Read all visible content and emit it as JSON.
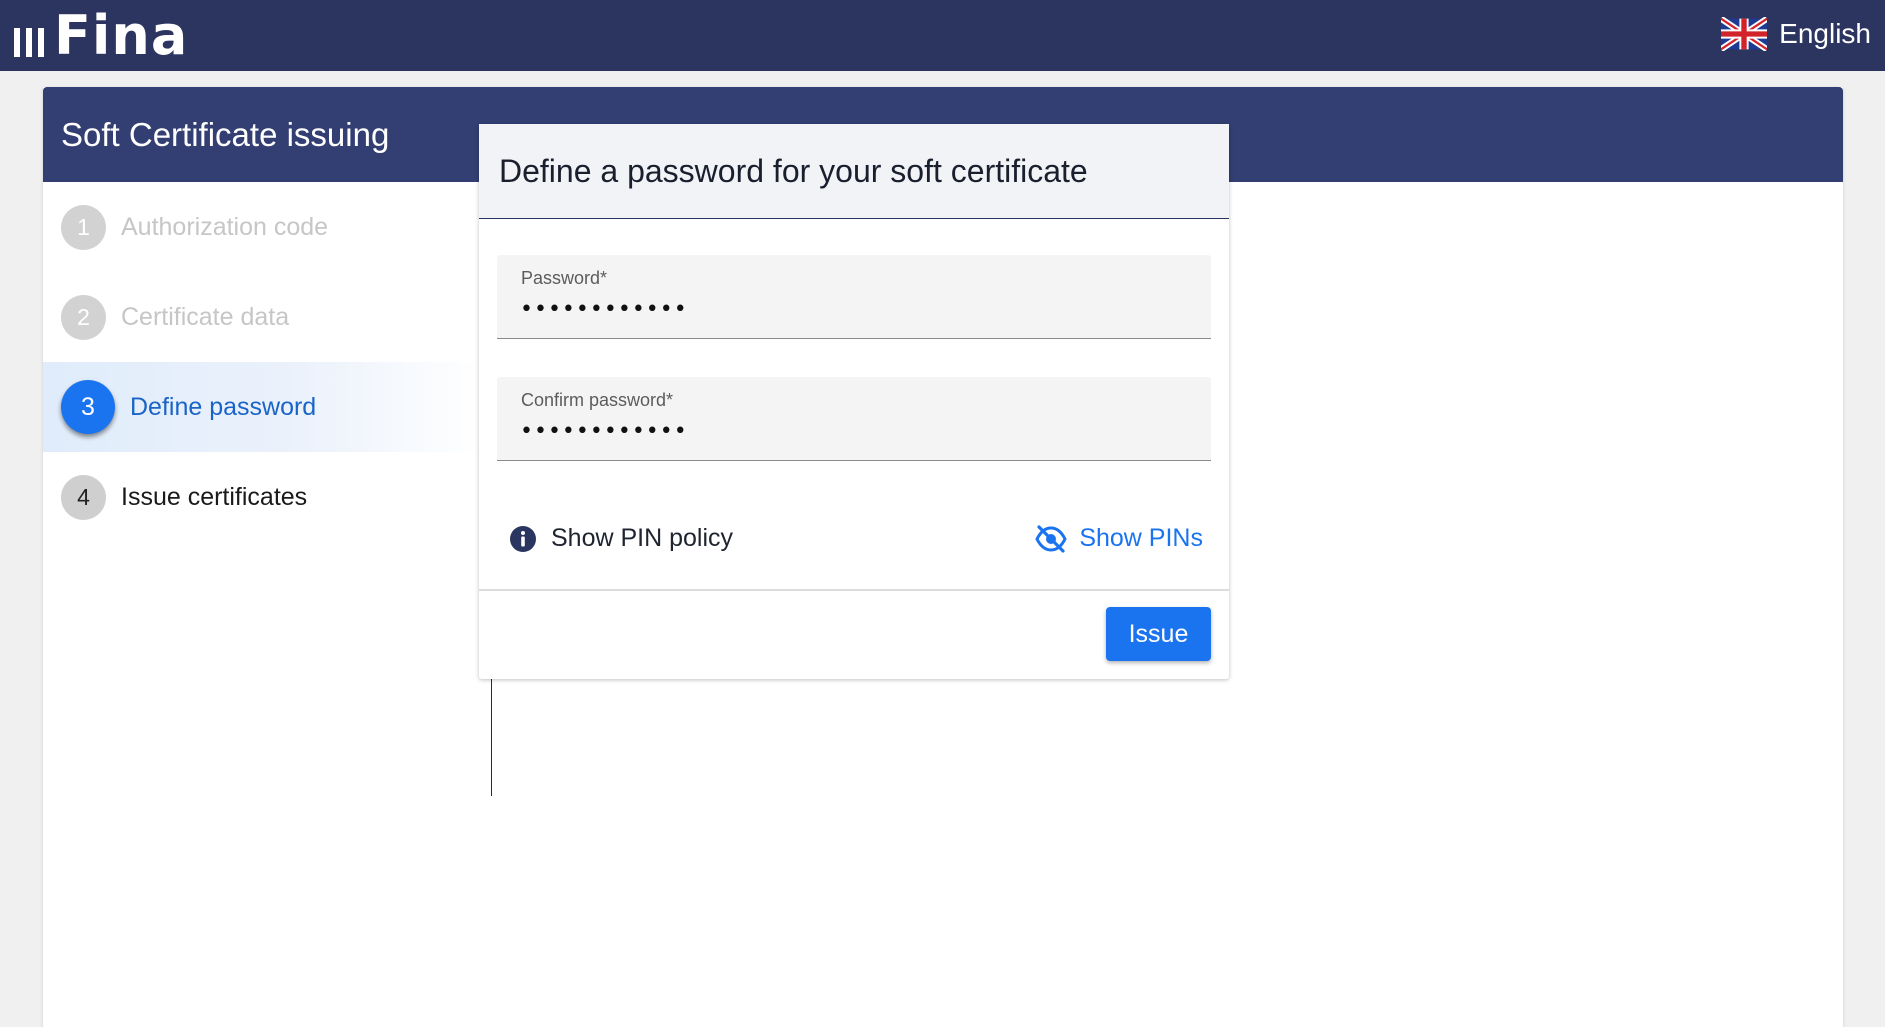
{
  "app": {
    "logo_text": "Fina",
    "language": "English"
  },
  "panel": {
    "title": "Soft Certificate issuing"
  },
  "steps": [
    {
      "number": "1",
      "label": "Authorization code",
      "state": "completed"
    },
    {
      "number": "2",
      "label": "Certificate data",
      "state": "completed"
    },
    {
      "number": "3",
      "label": "Define password",
      "state": "active"
    },
    {
      "number": "4",
      "label": "Issue certificates",
      "state": "pending"
    }
  ],
  "form": {
    "title": "Define a password for your soft certificate",
    "password": {
      "label": "Password*",
      "value": "••••••••••••"
    },
    "confirm_password": {
      "label": "Confirm password*",
      "value": "••••••••••••"
    },
    "pin_policy_label": "Show PIN policy",
    "show_pins_label": "Show PINs",
    "issue_label": "Issue"
  },
  "colors": {
    "topbar": "#2c3560",
    "panel_header": "#333f72",
    "accent": "#1a74ef"
  }
}
